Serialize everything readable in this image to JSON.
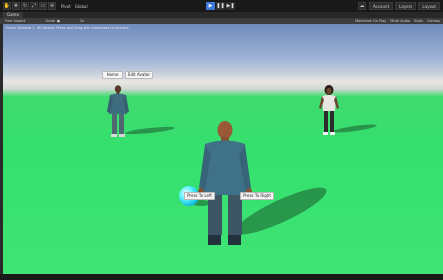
{
  "toolbar": {
    "tool_icons": [
      "hand-icon",
      "move-icon",
      "rotate-icon",
      "scale-icon",
      "rect-icon",
      "transform-icon"
    ],
    "pivot_label": "Pivot",
    "global_label": "Global",
    "play_icons": [
      "play-icon",
      "pause-icon",
      "step-icon"
    ],
    "account_label": "Account",
    "layers_label": "Layers",
    "layout_label": "Layout"
  },
  "tabs": {
    "game_tab": "Game"
  },
  "gamebar": {
    "display_label": "Free Aspect",
    "scale_label": "Scale",
    "scale_value": "1x",
    "maximize_label": "Maximize On Play",
    "mute_label": "Mute Audio",
    "stats_label": "Stats",
    "gizmos_label": "Gizmos"
  },
  "scene": {
    "overlay_text": "Game Window 1. 3D Avatar. Press and Drag the characters to interact",
    "home_button": "Home",
    "edit_avatar_button": "Edit Avatar",
    "press_left_button": "Press To Left",
    "press_right_button": "Press To Right"
  },
  "colors": {
    "ground": "#3fe474",
    "sky": "#9fb4d6",
    "jacket": "#3f7288",
    "ball": "#12bfe0"
  }
}
